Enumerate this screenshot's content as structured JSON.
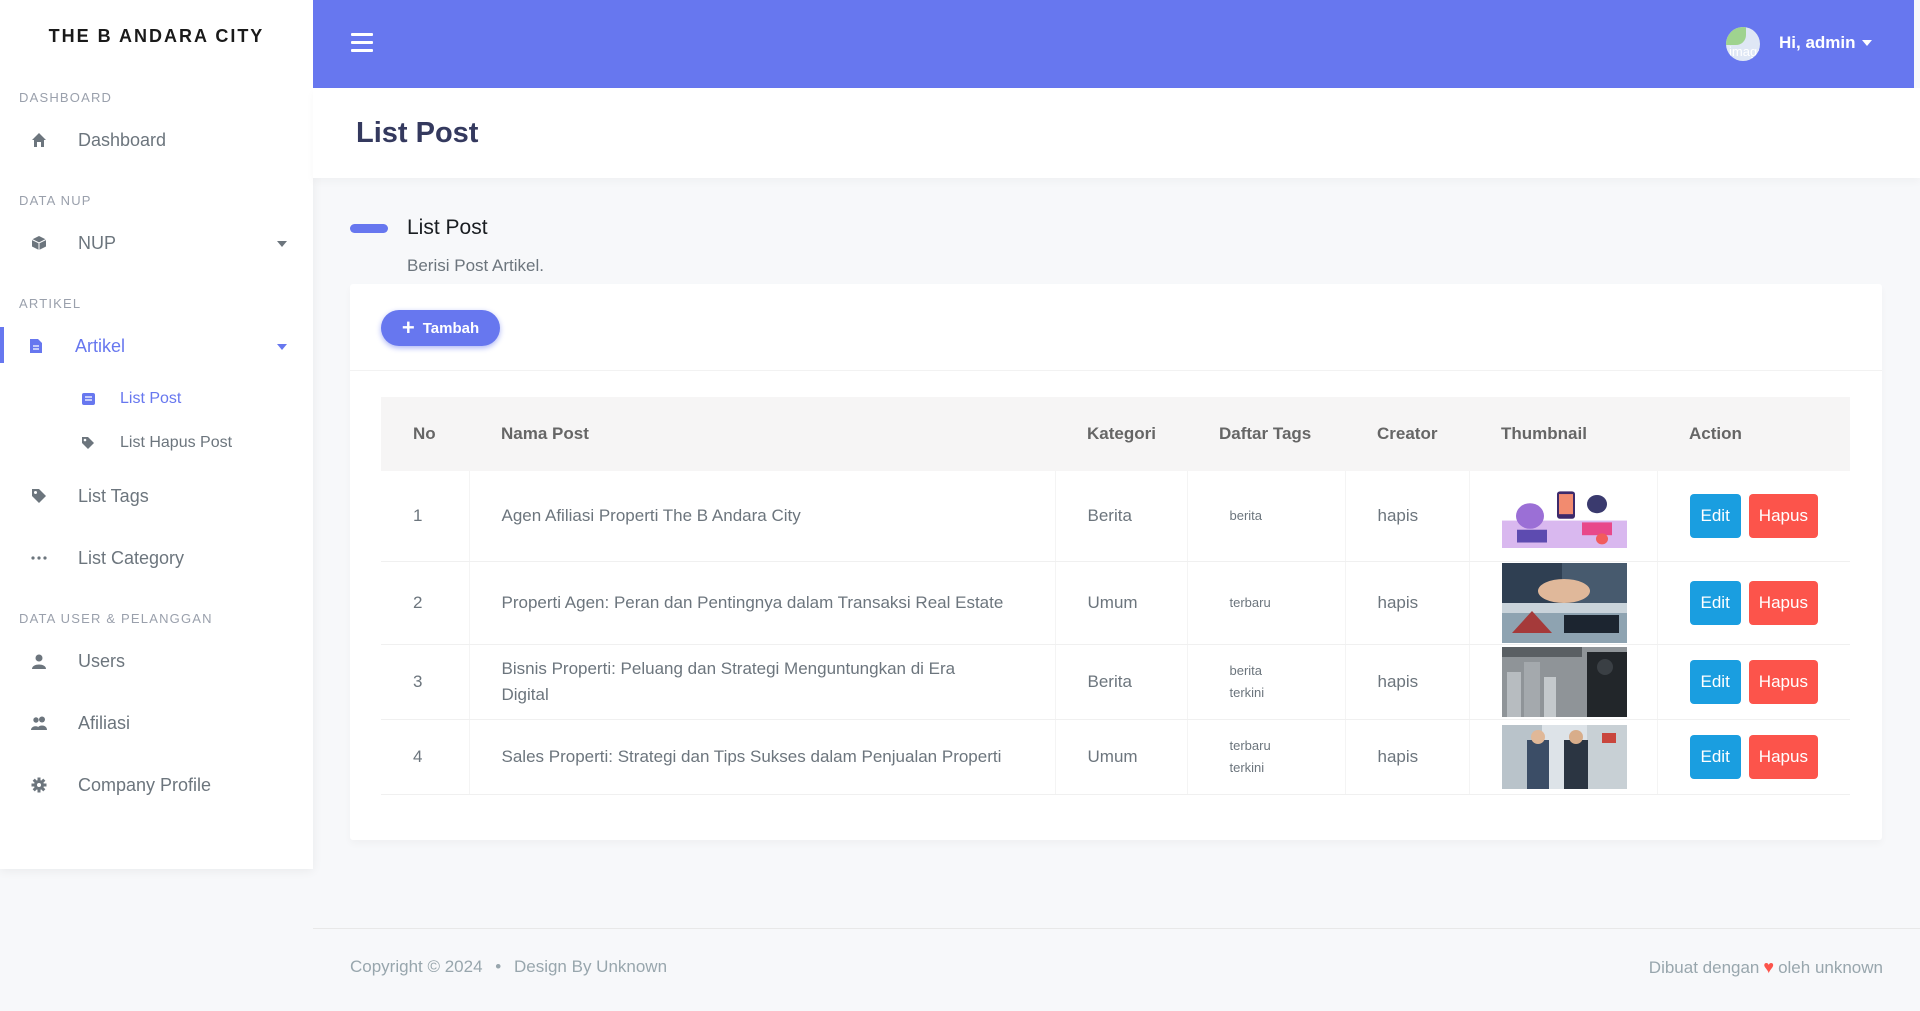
{
  "brand": "THE B ANDARA CITY",
  "sidebar": {
    "sections": [
      {
        "title": "DASHBOARD"
      },
      {
        "title": "DATA NUP"
      },
      {
        "title": "ARTIKEL"
      },
      {
        "title": "DATA USER & PELANGGAN"
      }
    ],
    "dashboard": "Dashboard",
    "nup": "NUP",
    "artikel": "Artikel",
    "list_post": "List Post",
    "list_hapus_post": "List Hapus Post",
    "list_tags": "List Tags",
    "list_category": "List Category",
    "users": "Users",
    "afiliasi": "Afiliasi",
    "company_profile": "Company Profile"
  },
  "topbar": {
    "avatar_alt": "image",
    "greeting": "Hi, admin"
  },
  "page_title": "List Post",
  "section": {
    "title": "List Post",
    "description": "Berisi Post Artikel."
  },
  "add_button": "Tambah",
  "table": {
    "headers": [
      "No",
      "Nama Post",
      "Kategori",
      "Daftar Tags",
      "Creator",
      "Thumbnail",
      "Action"
    ],
    "rows": [
      {
        "no": "1",
        "name": "Agen Afiliasi Properti The B Andara City",
        "category": "Berita",
        "tags": [
          "berita"
        ],
        "creator": "hapis"
      },
      {
        "no": "2",
        "name": "Properti Agen: Peran dan Pentingnya dalam Transaksi Real Estate",
        "category": "Umum",
        "tags": [
          "terbaru"
        ],
        "creator": "hapis"
      },
      {
        "no": "3",
        "name": "Bisnis Properti: Peluang dan Strategi Menguntungkan di Era Digital",
        "category": "Berita",
        "tags": [
          "berita",
          "terkini"
        ],
        "creator": "hapis"
      },
      {
        "no": "4",
        "name": "Sales Properti: Strategi dan Tips Sukses dalam Penjualan Properti",
        "category": "Umum",
        "tags": [
          "terbaru",
          "terkini"
        ],
        "creator": "hapis"
      }
    ],
    "edit_label": "Edit",
    "delete_label": "Hapus"
  },
  "footer": {
    "copyright": "Copyright © 2024",
    "bullet": "•",
    "design": "Design By Unknown",
    "made_with": "Dibuat dengan",
    "by": "oleh unknown"
  },
  "colors": {
    "primary": "#6777ef",
    "info": "#1a9ee0",
    "danger": "#fc544b"
  }
}
